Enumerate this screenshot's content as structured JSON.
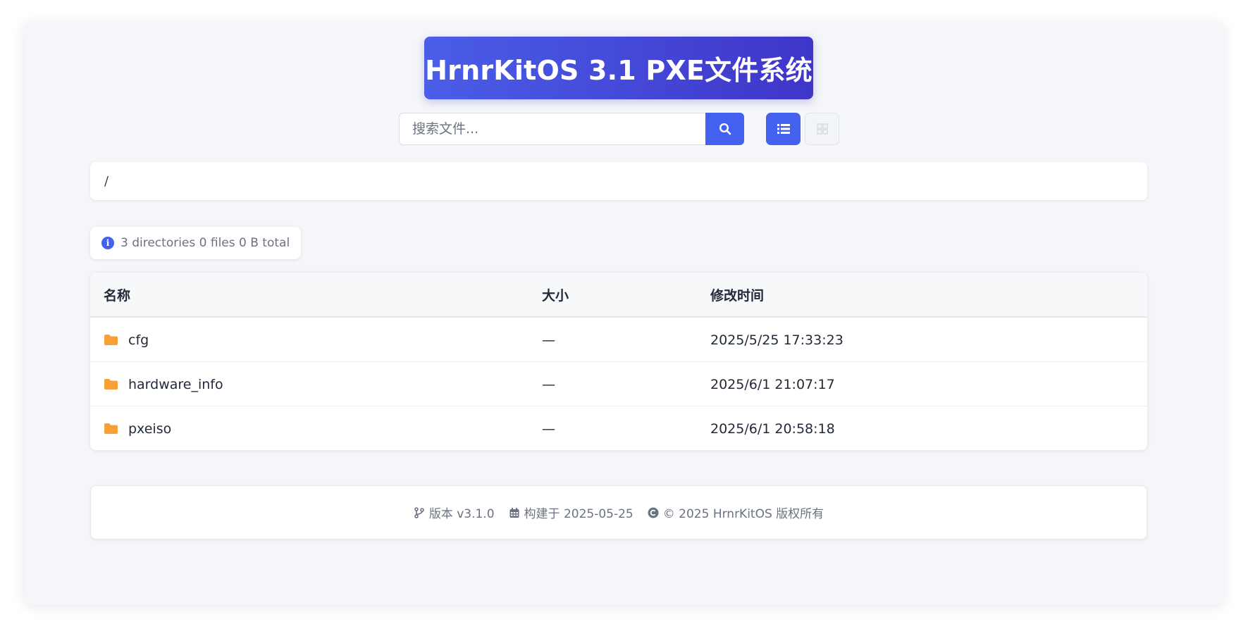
{
  "header": {
    "title": "HrnrKitOS 3.1 PXE文件系统"
  },
  "search": {
    "placeholder": "搜索文件..."
  },
  "icons": {
    "search": "search-icon",
    "list_view": "list-view-icon",
    "grid_view": "grid-view-icon",
    "info": "info-icon",
    "folder": "folder-icon",
    "branch": "code-branch-icon",
    "calendar": "calendar-icon",
    "copyright": "copyright-icon"
  },
  "view": {
    "active": "list"
  },
  "breadcrumb": {
    "path": "/"
  },
  "stats": {
    "text": "3 directories 0 files 0 B total"
  },
  "table": {
    "columns": [
      "名称",
      "大小",
      "修改时间"
    ],
    "rows": [
      {
        "name": "cfg",
        "size": "—",
        "modified": "2025/5/25 17:33:23"
      },
      {
        "name": "hardware_info",
        "size": "—",
        "modified": "2025/6/1 21:07:17"
      },
      {
        "name": "pxeiso",
        "size": "—",
        "modified": "2025/6/1 20:58:18"
      }
    ]
  },
  "footer": {
    "version": "版本 v3.1.0",
    "build": "构建于 2025-05-25",
    "copyright": "© 2025 HrnrKitOS 版权所有"
  },
  "colors": {
    "accent": "#4361ee",
    "title_gradient_start": "#4a5ee8",
    "title_gradient_end": "#3f35c9",
    "folder": "#f7a035",
    "background": "#f5f6f9"
  }
}
